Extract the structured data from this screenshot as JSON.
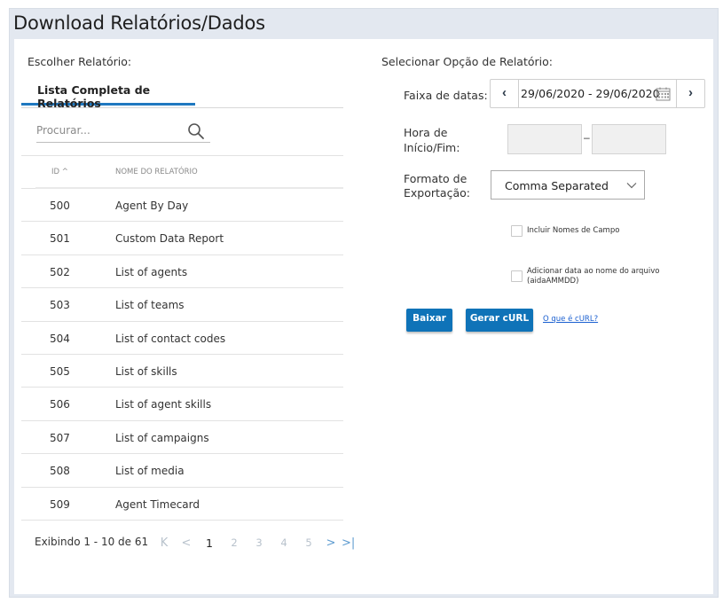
{
  "header": {
    "title": "Download Relatórios/Dados"
  },
  "left": {
    "choose_label": "Escolher Relatório:",
    "tab_label": "Lista Completa de Relatórios",
    "search_placeholder": "Procurar...",
    "table": {
      "col_id": "ID ^",
      "col_name": "NOME DO RELATÓRIO",
      "rows": [
        {
          "id": "500",
          "name": "Agent By Day"
        },
        {
          "id": "501",
          "name": "Custom Data Report"
        },
        {
          "id": "502",
          "name": "List of agents"
        },
        {
          "id": "503",
          "name": "List of teams"
        },
        {
          "id": "504",
          "name": "List of contact codes"
        },
        {
          "id": "505",
          "name": "List of skills"
        },
        {
          "id": "506",
          "name": "List of agent skills"
        },
        {
          "id": "507",
          "name": "List of campaigns"
        },
        {
          "id": "508",
          "name": "List of media"
        },
        {
          "id": "509",
          "name": "Agent Timecard"
        }
      ]
    },
    "pager": {
      "info": "Exibindo 1 - 10 de 61",
      "first": "K",
      "prev": "<",
      "pages": [
        "1",
        "2",
        "3",
        "4",
        "5"
      ],
      "current_page": "1",
      "next": ">",
      "last": ">|"
    }
  },
  "right": {
    "select_label": "Selecionar Opção de Relatório:",
    "date_range_label": "Faixa de datas:",
    "date_range_value": "29/06/2020 - 29/06/2020",
    "time_label_1": "Hora de",
    "time_label_2": "Início/Fim:",
    "time_separator": "–",
    "format_label_1": "Formato de",
    "format_label_2": "Exportação:",
    "format_value": "Comma Separated",
    "cb1_label": "Incluir Nomes de Campo",
    "cb2_label_1": "Adicionar data ao nome do arquivo",
    "cb2_label_2": "(aidaAMMDD)",
    "download_button": "Baixar",
    "curl_button": "Gerar cURL",
    "curl_link": "O que é cURL?"
  },
  "colors": {
    "accent": "#1f78c0",
    "button": "#0f73b8",
    "frame": "#e3e8f0",
    "link": "#1a5fd0"
  },
  "icons": [
    "search-icon",
    "chevron-left-icon",
    "chevron-right-icon",
    "calendar-icon",
    "chevron-down-icon"
  ]
}
